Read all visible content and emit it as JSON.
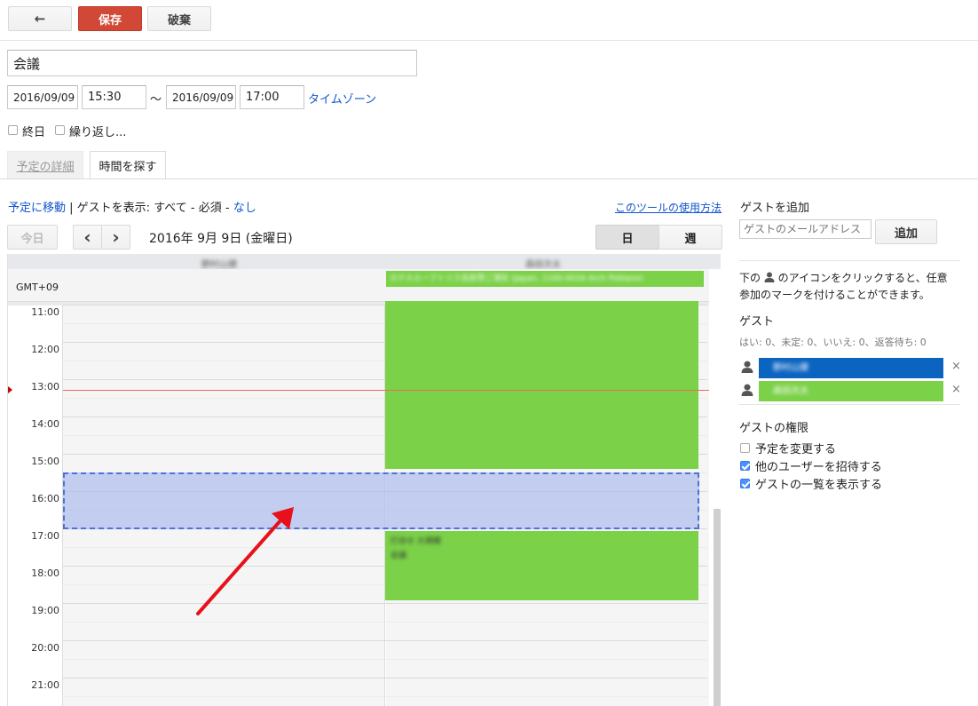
{
  "toolbar": {
    "back_glyph": "←",
    "save_label": "保存",
    "discard_label": "破棄"
  },
  "event": {
    "title": "会議",
    "start_date": "2016/09/09",
    "start_time": "15:30",
    "range_sep": "〜",
    "end_date": "2016/09/09",
    "end_time": "17:00",
    "timezone_link": "タイムゾーン",
    "all_day_label": "終日",
    "repeat_label": "繰り返し..."
  },
  "tabs": {
    "details": "予定の詳細",
    "find_time": "時間を探す"
  },
  "find_time": {
    "go_to_event": "予定に移動",
    "sep": " | ",
    "show_guests_prefix": "ゲストを表示: ",
    "show_all": "すべて",
    "dash1": " - ",
    "show_required": "必須",
    "dash2": " - ",
    "show_none": "なし",
    "help_link": "このツールの使用方法",
    "today_button": "今日",
    "prev_glyph": "‹",
    "next_glyph": "›",
    "date_heading": "2016年 9月 9日 (金曜日)",
    "day_button": "日",
    "week_button": "週",
    "timezone_label": "GMT+09",
    "guest_col_1": "野村山健",
    "guest_col_2": "森田次太",
    "allday_event_text": "ホテルルーフトリス名前帯ご滞在 (Japan, 1100-0016 Arch Poblano)",
    "blurred_event_text_1": "打合せ 大規模",
    "blurred_event_text_2": "会議",
    "hours": [
      "11:00",
      "12:00",
      "13:00",
      "14:00",
      "15:00",
      "16:00",
      "17:00",
      "18:00",
      "19:00",
      "20:00",
      "21:00"
    ]
  },
  "sidebar": {
    "add_guest_title": "ゲストを追加",
    "guest_email_placeholder": "ゲストのメールアドレス",
    "add_button": "追加",
    "hint_prefix": "下の",
    "hint_suffix": "のアイコンをクリックすると、任意",
    "hint_line2": "参加のマークを付けることができます。",
    "guests_title": "ゲスト",
    "guest_counts": "はい: 0、未定: 0、いいえ: 0、返答待ち: 0",
    "guests": [
      {
        "name": "野村山健",
        "color": "#0b64c0"
      },
      {
        "name": "森田次太",
        "color": "#7bd148"
      }
    ],
    "remove_glyph": "×",
    "permissions_title": "ゲストの権限",
    "permissions": [
      {
        "label": "予定を変更する",
        "checked": false
      },
      {
        "label": "他のユーザーを招待する",
        "checked": true
      },
      {
        "label": "ゲストの一覧を表示する",
        "checked": true
      }
    ]
  },
  "colors": {
    "save_red": "#d14836",
    "busy_green": "#7bd148",
    "selection_blue": "#c3cdf0",
    "now_line": "#e96d5e",
    "arrow_red": "#e8111b"
  }
}
